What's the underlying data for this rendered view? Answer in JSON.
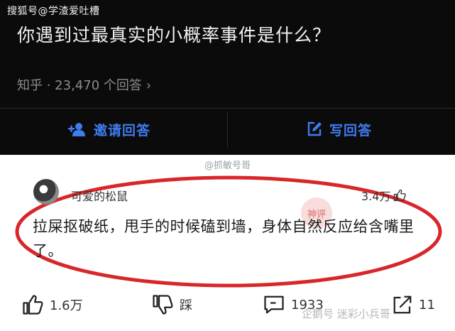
{
  "watermark_top": "搜狐号@学渣爱吐槽",
  "question": {
    "title": "你遇到过最真实的小概率事件是什么？",
    "meta": "知乎 · 23,470 个回答",
    "meta_chevron": "›"
  },
  "actions_top": {
    "invite_label": "邀请回答",
    "write_label": "写回答"
  },
  "weibo_mark": "@抓敏号哥",
  "answer": {
    "username": "可爱的松鼠",
    "like_count": "3.4万",
    "text": "拉屎抠破纸，甩手的时候磕到墙，身体自然反应给含嘴里了。",
    "stamp": "神评"
  },
  "bottom_bar": {
    "like_count": "1.6万",
    "dislike_label": "踩",
    "comment_count": "1933",
    "share_count": "11"
  },
  "watermark_bottom": "企鹅号 迷彩小兵哥",
  "colors": {
    "header_bg": "#0b0b0c",
    "accent_blue": "#3f7cf0",
    "highlight_red": "#d8262a"
  }
}
